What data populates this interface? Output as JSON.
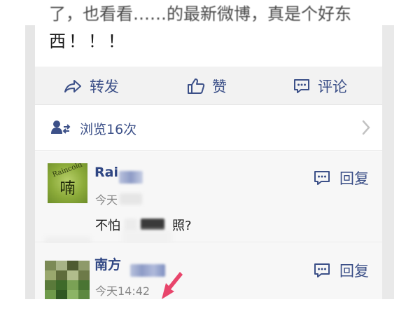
{
  "post": {
    "line1": "了，也看看……的最新微博，真是个好东",
    "line2": "西！！！"
  },
  "actions": {
    "forward_label": "转发",
    "like_label": "赞",
    "comment_label": "评论"
  },
  "views": {
    "label": "浏览16次"
  },
  "comments": [
    {
      "avatar_text_ring": "Raincold",
      "avatar_text_center": "喃",
      "name": "Rai",
      "time": "今天",
      "body_start": "不怕",
      "body_end": "照?",
      "reply_label": "回复"
    },
    {
      "name": "南方",
      "time": "今天14:42",
      "reply_label": "回复"
    }
  ],
  "colors": {
    "link_blue": "#3c5088",
    "name_blue": "#2f4683",
    "arrow_pink": "#e8456b"
  }
}
